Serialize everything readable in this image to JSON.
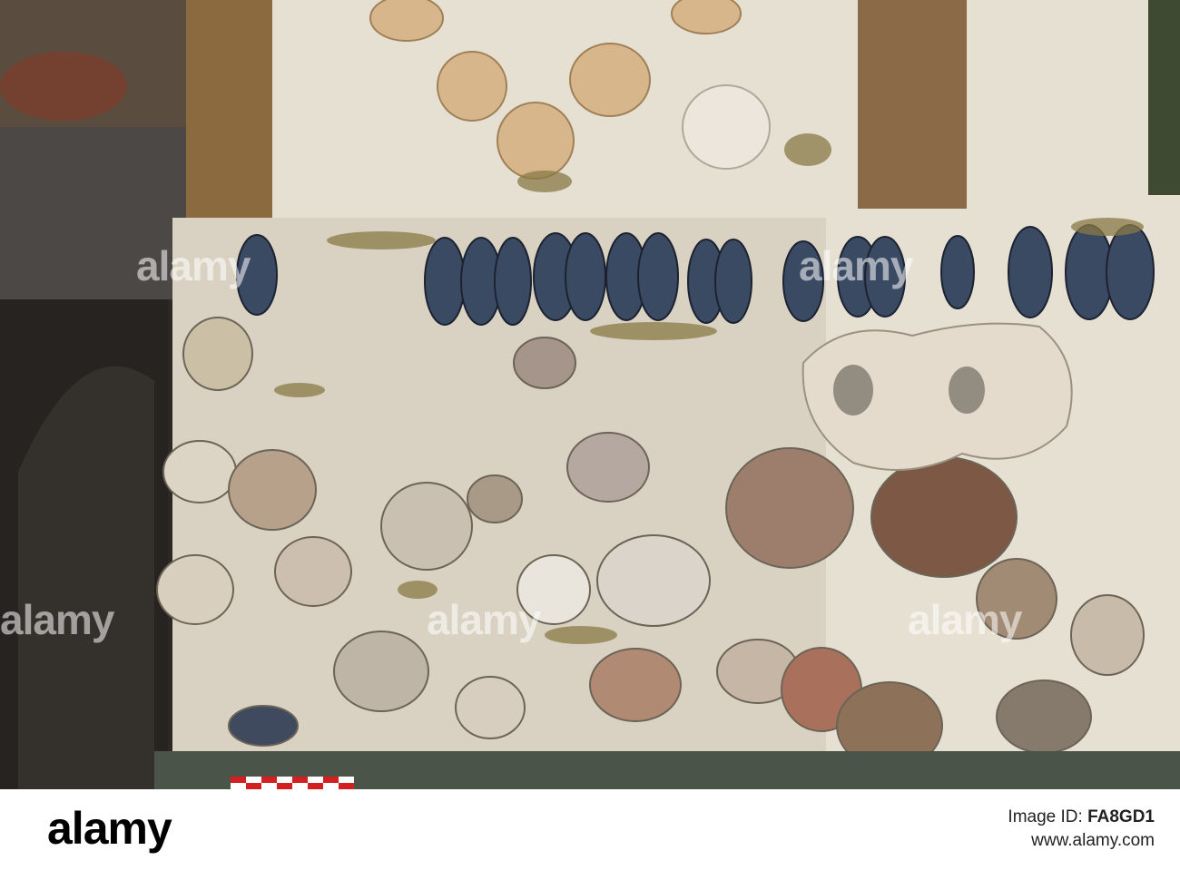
{
  "image": {
    "description_free": true,
    "palette": {
      "plaster": "#e9e4da",
      "shadow": "#2a2622",
      "mussel": "#3b4a63",
      "moss": "#8a7a45",
      "stone": "#a89e8c",
      "terracotta": "#a46b55",
      "dark_wall": "#3a3632"
    }
  },
  "watermark": {
    "text": "alamy"
  },
  "footer": {
    "logo": "alamy",
    "image_id_label": "Image ID:",
    "image_id": "FA8GD1",
    "url": "www.alamy.com"
  }
}
